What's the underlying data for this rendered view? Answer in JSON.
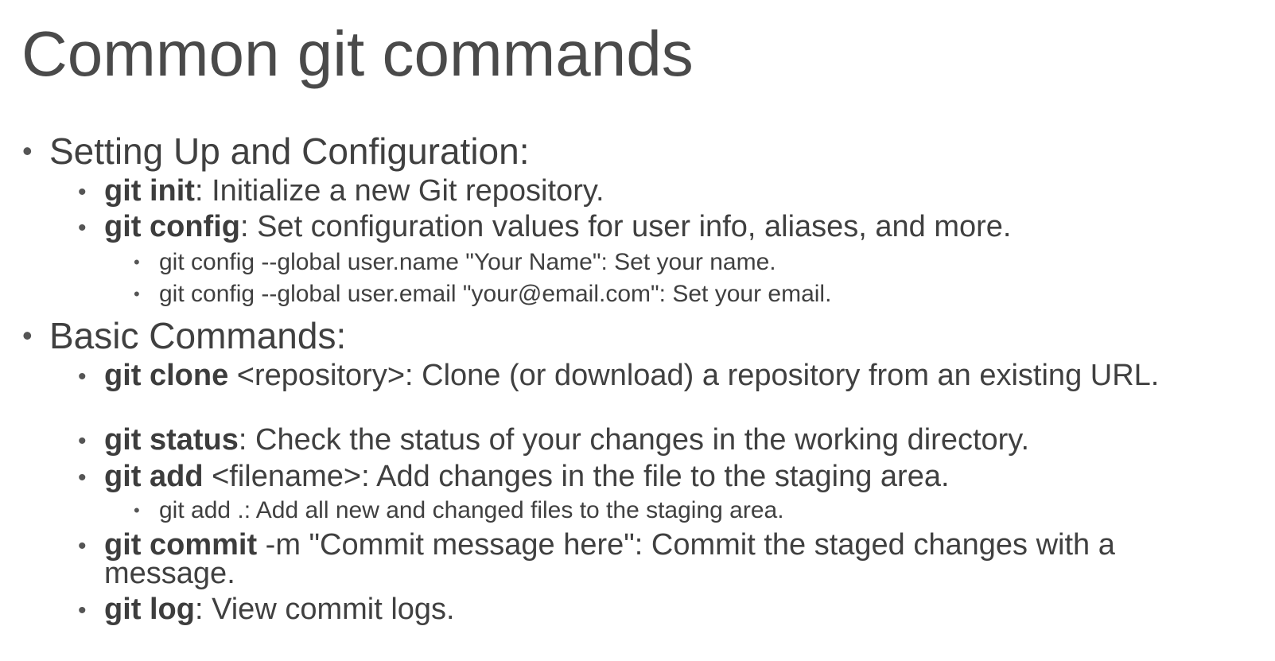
{
  "slide": {
    "title": "Common git commands",
    "sections": [
      {
        "heading": "Setting Up and Configuration:",
        "items": [
          {
            "cmd": "git init",
            "rest": ": Initialize a new Git repository."
          },
          {
            "cmd": "git config",
            "rest": ": Set configuration values for user info, aliases, and more.",
            "sub": [
              "git config --global user.name \"Your Name\": Set your name.",
              "git config --global user.email \"your@email.com\": Set your email."
            ]
          }
        ]
      },
      {
        "heading": "Basic Commands:",
        "items": [
          {
            "cmd": "git clone",
            "rest": " <repository>: Clone (or download) a repository from an existing URL."
          },
          {
            "cmd": "git status",
            "rest": ": Check the status of your changes in the working directory."
          },
          {
            "cmd": "git add",
            "rest": " <filename>: Add changes in the file to the staging area.",
            "sub": [
              "git add .: Add all new and changed files to the staging area."
            ]
          },
          {
            "cmd": "git commit",
            "rest": " -m \"Commit message here\": Commit the staged changes with a message."
          },
          {
            "cmd": "git log",
            "rest": ": View commit logs."
          }
        ]
      }
    ]
  }
}
